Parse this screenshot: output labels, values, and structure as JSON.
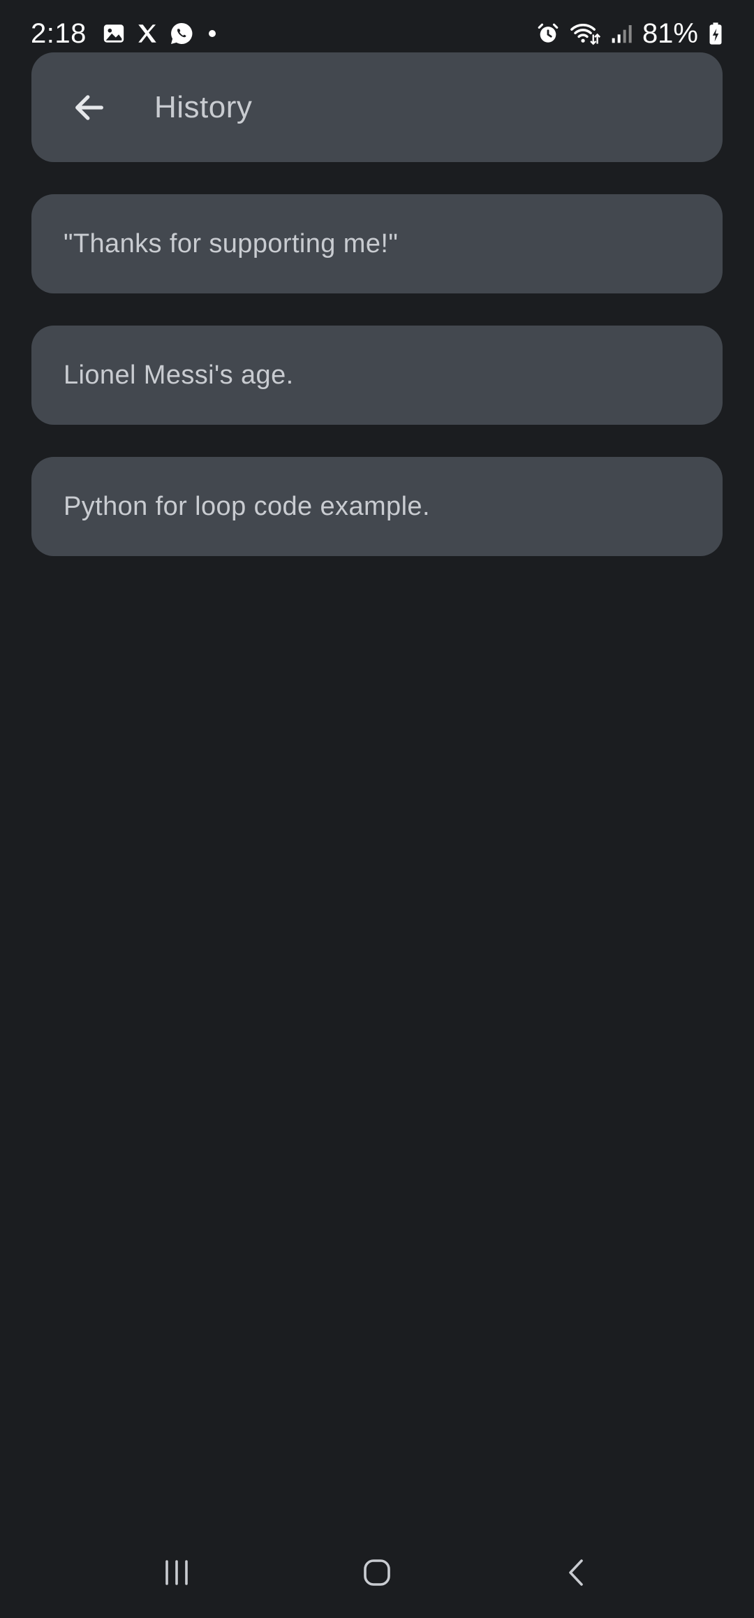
{
  "status_bar": {
    "time": "2:18",
    "battery_percent": "81%",
    "left_icons": [
      "gallery-icon",
      "x-icon",
      "whatsapp-icon",
      "dot-icon"
    ],
    "right_icons": [
      "alarm-icon",
      "wifi-icon",
      "signal-icon",
      "battery-charging-icon"
    ]
  },
  "app_bar": {
    "title": "History",
    "back_icon": "arrow-back-icon"
  },
  "history": {
    "items": [
      {
        "label": "\"Thanks for supporting me!\""
      },
      {
        "label": "Lionel Messi's age."
      },
      {
        "label": "Python for loop code example."
      }
    ]
  },
  "nav_bar": {
    "buttons": [
      "recents-icon",
      "home-icon",
      "back-icon"
    ]
  },
  "colors": {
    "background": "#1b1d20",
    "surface": "#43484f",
    "text": "#c9ccd1"
  }
}
